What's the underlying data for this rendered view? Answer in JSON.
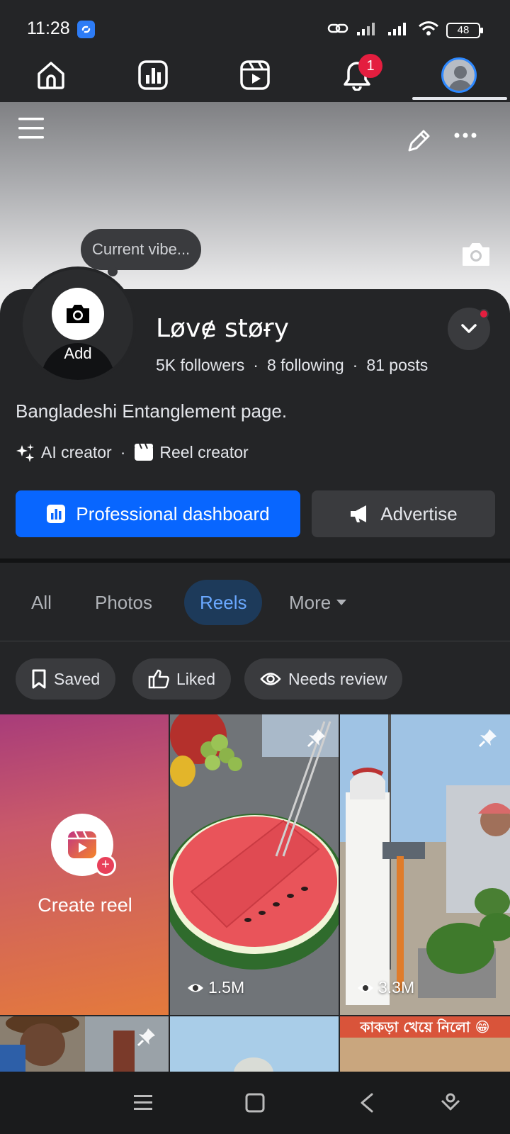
{
  "status_bar": {
    "time": "11:28",
    "battery": "48"
  },
  "top_nav": {
    "items": [
      {
        "icon": "home-icon"
      },
      {
        "icon": "dashboard-icon"
      },
      {
        "icon": "reels-icon"
      },
      {
        "icon": "notifications-icon",
        "badge": "1"
      },
      {
        "icon": "profile-avatar-icon",
        "active": true
      }
    ]
  },
  "profile": {
    "vibe_placeholder": "Current vibe...",
    "add_photo_label": "Add",
    "name": "Løvɇ støɍy",
    "followers": "5K followers",
    "following": "8 following",
    "posts": "81 posts",
    "separator": "·",
    "bio": "Bangladeshi Entanglement page.",
    "badges": [
      {
        "icon": "ai-sparkle-icon",
        "label": "AI creator"
      },
      {
        "icon": "clapperboard-icon",
        "label": "Reel creator"
      }
    ]
  },
  "actions": {
    "professional_dashboard": "Professional dashboard",
    "advertise": "Advertise"
  },
  "tabs": {
    "all": "All",
    "photos": "Photos",
    "reels": "Reels",
    "more": "More",
    "active": "Reels"
  },
  "filters": {
    "saved": "Saved",
    "liked": "Liked",
    "needs_review": "Needs review"
  },
  "reels": {
    "create_label": "Create reel",
    "items": [
      {
        "views": "1.5M",
        "pinned": true,
        "thumb": "watermelon slices"
      },
      {
        "views": "3.3M",
        "pinned": true,
        "thumb": "man with watermelons on scale"
      },
      {
        "views": "",
        "pinned": true,
        "thumb": "man in hat"
      },
      {
        "views": "",
        "pinned": false,
        "thumb": "blue background"
      },
      {
        "views": "",
        "pinned": false,
        "thumb": "sand with caption",
        "caption": "কাকড়া খেয়ে নিলো 😁"
      }
    ]
  },
  "colors": {
    "background": "#242527",
    "primary_button": "#0866ff",
    "secondary_button": "#3a3b3e",
    "active_tab_text": "#6aa8ff",
    "notification_badge": "#e41e3f"
  }
}
